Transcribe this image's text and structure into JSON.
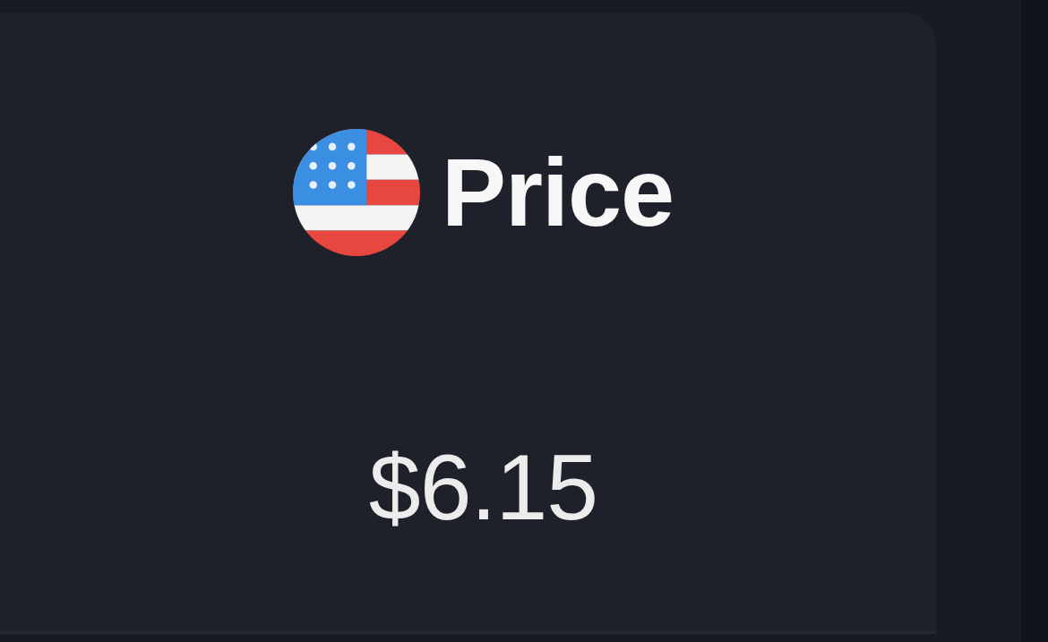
{
  "price_card": {
    "label": "Price",
    "value": "$6.15"
  }
}
